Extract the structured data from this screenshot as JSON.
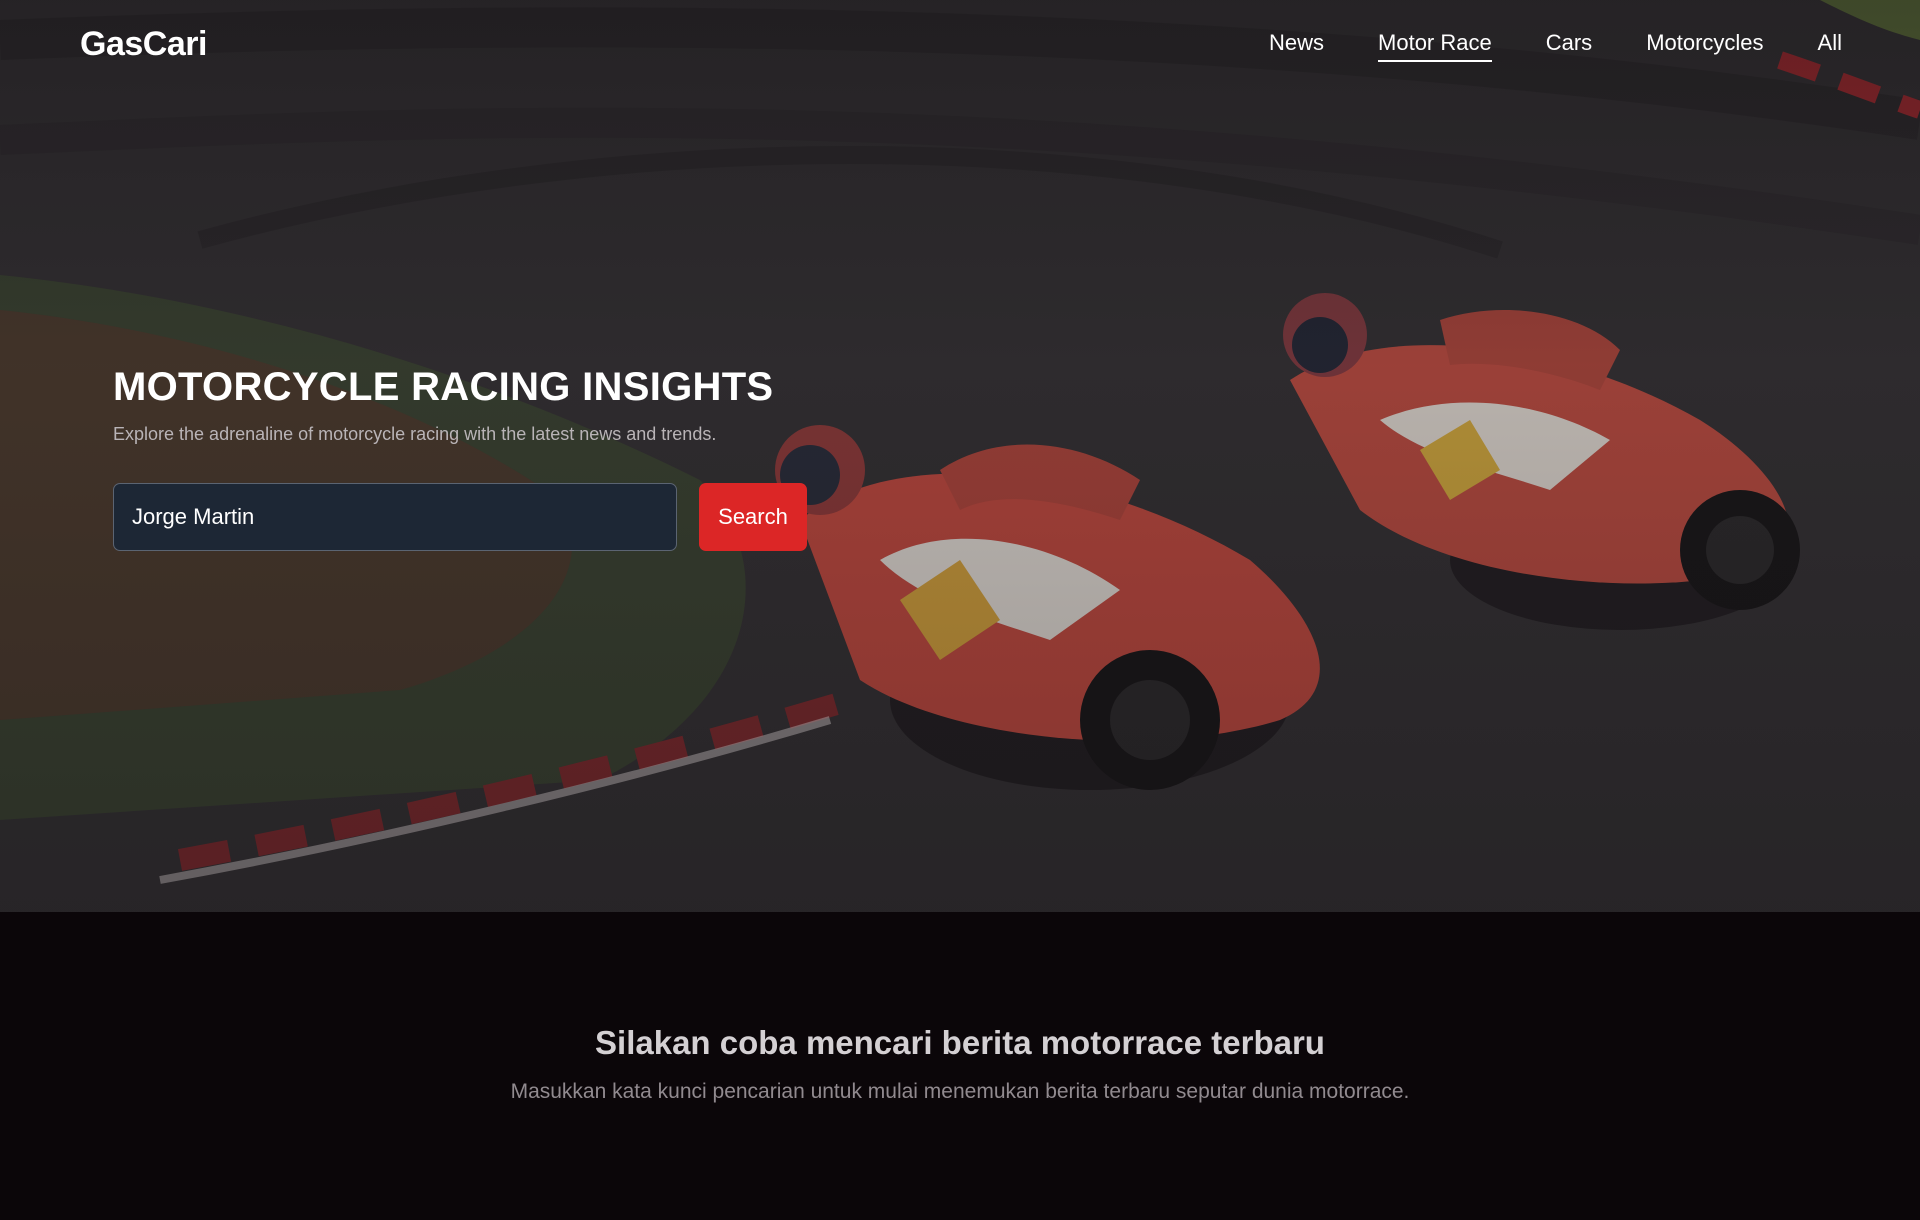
{
  "app": {
    "logo": "GasCari"
  },
  "nav": {
    "items": [
      {
        "label": "News",
        "active": false
      },
      {
        "label": "Motor Race",
        "active": true
      },
      {
        "label": "Cars",
        "active": false
      },
      {
        "label": "Motorcycles",
        "active": false
      },
      {
        "label": "All",
        "active": false
      }
    ]
  },
  "hero": {
    "title": "MOTORCYCLE RACING INSIGHTS",
    "subtitle": "Explore the adrenaline of motorcycle racing with the latest news and trends.",
    "background_image": "motorcycle-racers-on-track-photo"
  },
  "search": {
    "value": "Jorge Martin",
    "button_label": "Search"
  },
  "results": {
    "title": "Silakan coba mencari berita motorrace terbaru",
    "text": "Masukkan kata kunci pencarian untuk mulai menemukan berita terbaru seputar dunia motorrace."
  },
  "colors": {
    "accent": "#dc2626",
    "page_background": "#0b0609",
    "input_background": "#1d2735"
  }
}
